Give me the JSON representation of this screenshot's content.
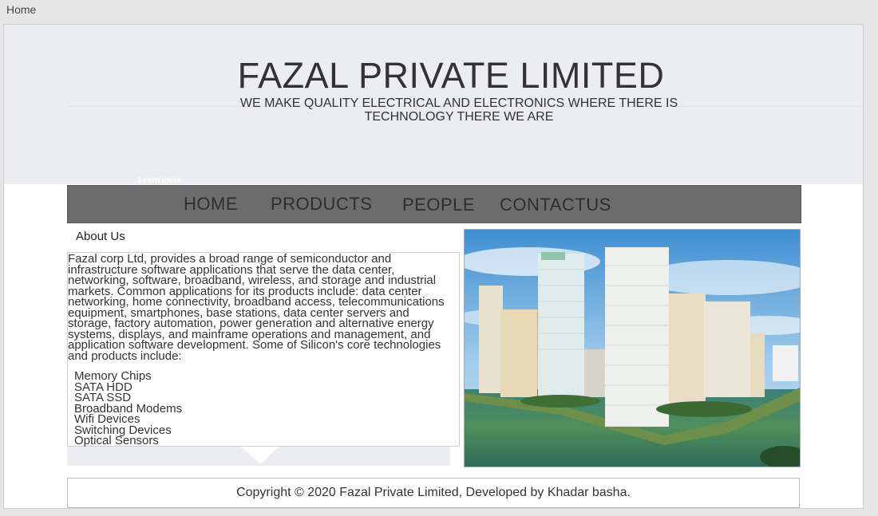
{
  "browser": {
    "tab_label": "Home"
  },
  "hero": {
    "title": "FAZAL PRIVATE LIMITED",
    "tagline": "WE MAKE QUALITY ELECTRICAL AND ELECTRONICS WHERE THERE IS TECHNOLOGY THERE WE ARE",
    "learn_more": "Learn more"
  },
  "nav": {
    "items": [
      {
        "label": "HOME"
      },
      {
        "label": "PRODUCTS"
      },
      {
        "label": "PEOPLE"
      },
      {
        "label": "CONTACTUS"
      }
    ]
  },
  "about": {
    "heading": "About Us",
    "body": "Fazal corp Ltd, provides a broad range of semiconductor and infrastructure software applications that serve the data center, networking, software, broadband, wireless, and storage and industrial markets. Common applications for its products include: data center networking, home connectivity, broadband access, telecommunications equipment, smartphones, base stations, data center servers and storage, factory automation, power generation and alternative energy systems, displays, and mainframe operations and management, and application software development. Some of Silicon's core technologies and products include:",
    "products": [
      "Memory Chips",
      "SATA HDD",
      "SATA SSD",
      "Broadband Modems",
      "Wifi Devices",
      "Switching Devices",
      "Optical Sensors"
    ]
  },
  "footer": {
    "copyright": "Copyright © 2020 Fazal Private Limited, Developed by Khadar basha."
  },
  "colors": {
    "hero_bg": "#ecedf0",
    "nav_bg": "#6c6c6c",
    "text": "#333333"
  }
}
